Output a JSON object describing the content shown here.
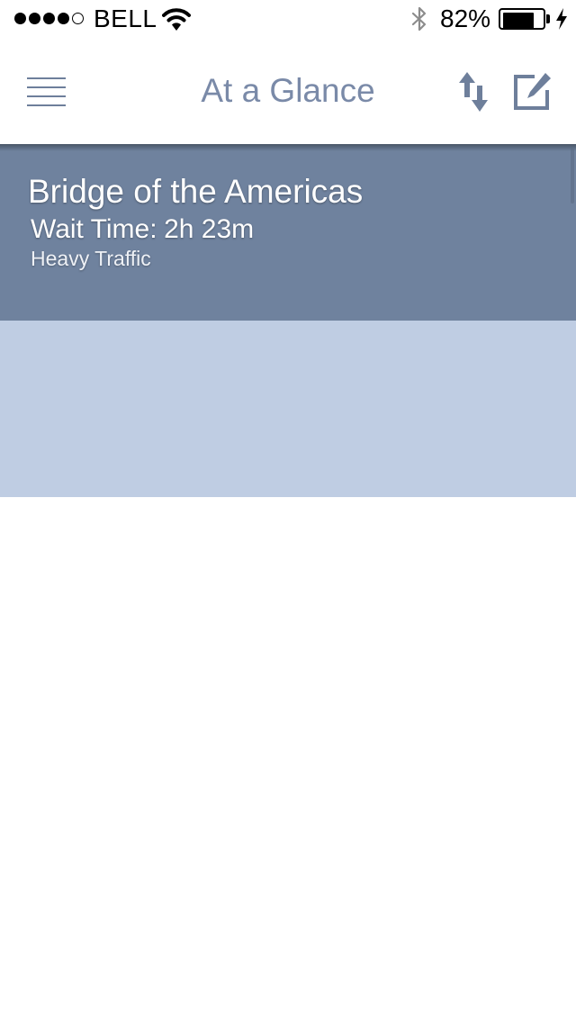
{
  "status_bar": {
    "signal_bars_filled": 4,
    "signal_bars_total": 5,
    "carrier": "BELL",
    "wifi_icon": "wifi-icon",
    "bluetooth_icon": "bluetooth-icon",
    "battery_percent_text": "82%",
    "battery_level": 0.82,
    "charging_icon": "lightning-bolt-icon"
  },
  "nav": {
    "title": "At a Glance",
    "menu_icon": "hamburger-menu-icon",
    "sort_icon": "sort-arrows-icon",
    "edit_icon": "edit-icon"
  },
  "crossings": [
    {
      "name": "Bridge of the Americas",
      "wait_label": "Wait Time:",
      "wait_value": "2h 23m",
      "status": "Heavy Traffic"
    }
  ],
  "colors": {
    "accent": "#6f829e",
    "title_text": "#7a8aa8",
    "card_active": "#6f829e",
    "card_empty": "#bfcde3",
    "background": "#ffffff"
  }
}
